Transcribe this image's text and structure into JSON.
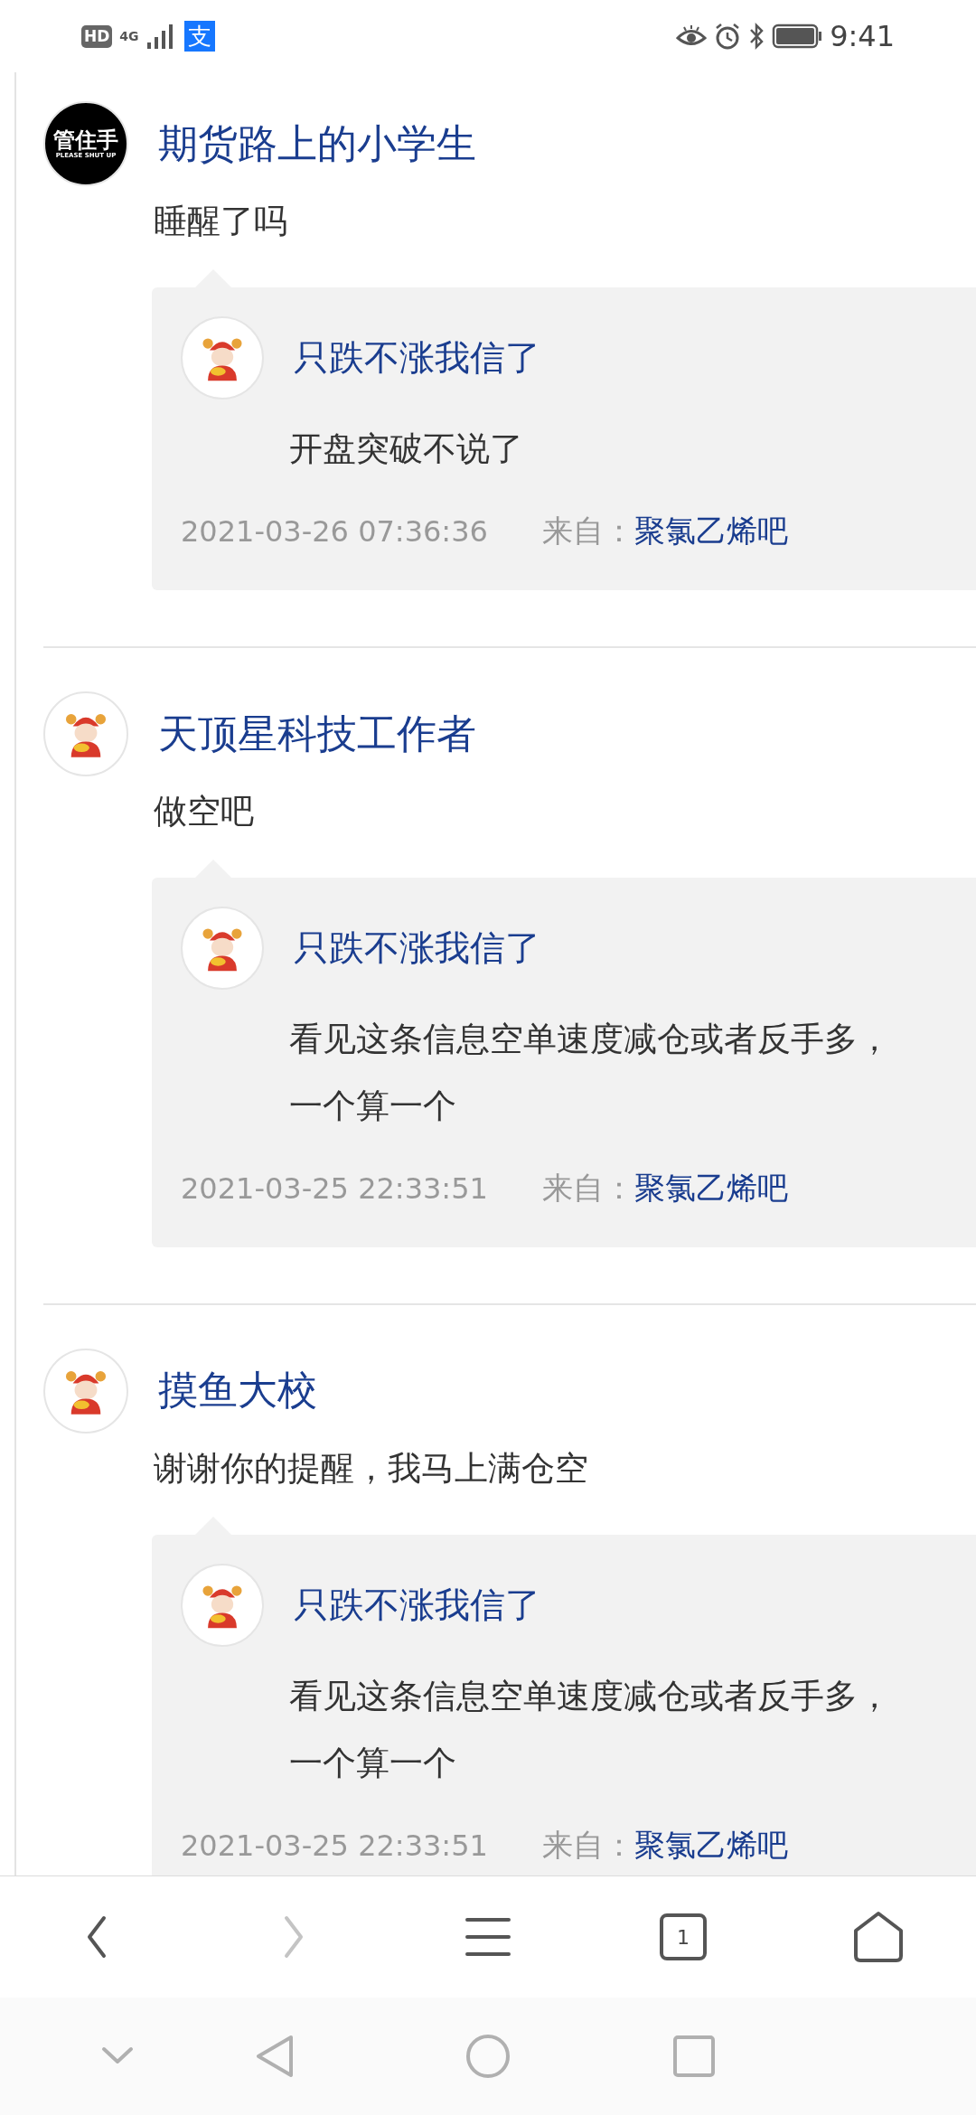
{
  "status_bar": {
    "hd_badge": "HD",
    "network": "4G",
    "app_badge": "支",
    "time": "9:41"
  },
  "comments": [
    {
      "avatar": {
        "kind": "logo",
        "title": "管住手",
        "caption": "PLEASE SHUT UP"
      },
      "author": "期货路上的小学生",
      "text": "睡醒了吗",
      "reply": {
        "avatar": {
          "kind": "figure"
        },
        "author": "只跌不涨我信了",
        "lines": [
          "开盘突破不说了"
        ],
        "date": "2021-03-26 07:36:36",
        "source_label": "来自：",
        "source": "聚氯乙烯吧"
      }
    },
    {
      "avatar": {
        "kind": "figure"
      },
      "author": "天顶星科技工作者",
      "text": "做空吧",
      "reply": {
        "avatar": {
          "kind": "figure"
        },
        "author": "只跌不涨我信了",
        "lines": [
          "看见这条信息空单速度减仓或者反手多，",
          "一个算一个"
        ],
        "date": "2021-03-25 22:33:51",
        "source_label": "来自：",
        "source": "聚氯乙烯吧"
      }
    },
    {
      "avatar": {
        "kind": "figure"
      },
      "author": "摸鱼大校",
      "text": "谢谢你的提醒，我马上满仓空",
      "reply": {
        "avatar": {
          "kind": "figure"
        },
        "author": "只跌不涨我信了",
        "lines": [
          "看见这条信息空单速度减仓或者反手多，",
          "一个算一个"
        ],
        "date": "2021-03-25 22:33:51",
        "source_label": "来自：",
        "source": "聚氯乙烯吧"
      }
    }
  ],
  "toolbar": [
    {
      "kind": "back",
      "disabled": false
    },
    {
      "kind": "forward",
      "disabled": true
    },
    {
      "kind": "menu",
      "disabled": false
    },
    {
      "kind": "tabs",
      "disabled": false,
      "count": "1"
    },
    {
      "kind": "home",
      "disabled": false
    }
  ]
}
